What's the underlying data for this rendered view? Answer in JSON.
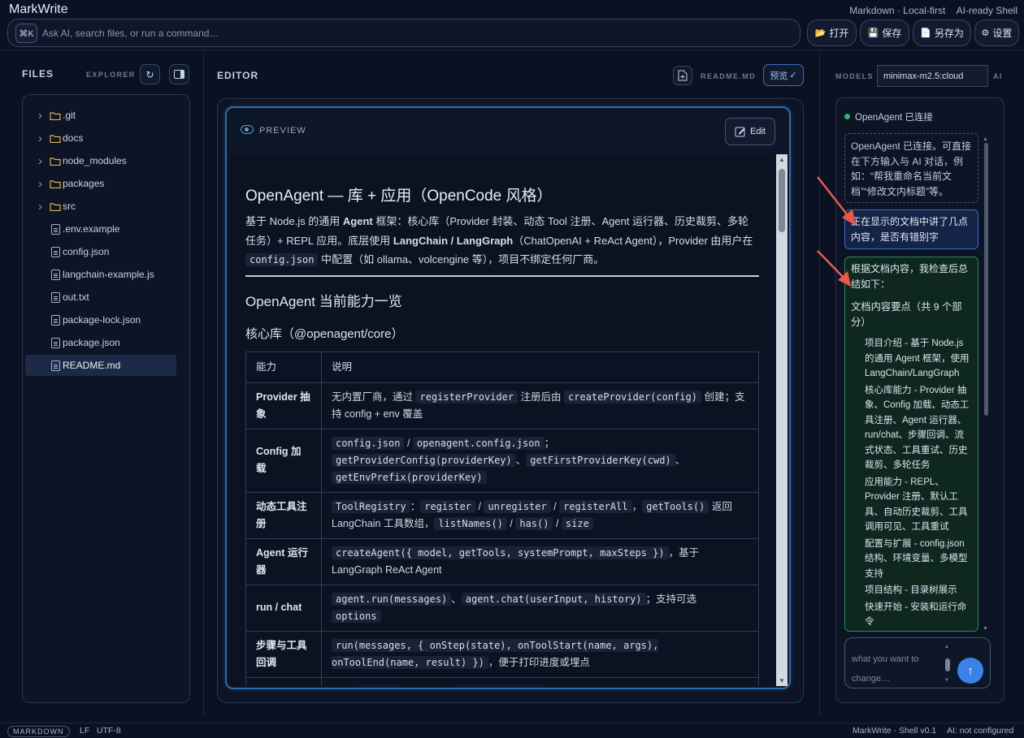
{
  "app": {
    "title": "MarkWrite",
    "tags": [
      "Markdown · Local-first",
      "AI-ready Shell"
    ]
  },
  "command_bar": {
    "shortcut": "⌘K",
    "placeholder": "Ask AI, search files, or run a command…"
  },
  "toolbar": {
    "open_label": "打开",
    "save_label": "保存",
    "save_as_label": "另存为",
    "settings_label": "设置"
  },
  "files": {
    "title": "FILES",
    "subtitle": "EXPLORER",
    "items": [
      {
        "name": ".git",
        "type": "folder"
      },
      {
        "name": "docs",
        "type": "folder"
      },
      {
        "name": "node_modules",
        "type": "folder"
      },
      {
        "name": "packages",
        "type": "folder"
      },
      {
        "name": "src",
        "type": "folder"
      },
      {
        "name": ".env.example",
        "type": "file"
      },
      {
        "name": "config.json",
        "type": "file"
      },
      {
        "name": "langchain-example.js",
        "type": "file"
      },
      {
        "name": "out.txt",
        "type": "file"
      },
      {
        "name": "package-lock.json",
        "type": "file"
      },
      {
        "name": "package.json",
        "type": "file"
      },
      {
        "name": "README.md",
        "type": "file",
        "active": true
      }
    ]
  },
  "editor": {
    "title": "EDITOR",
    "filename": "README.MD",
    "preview_toggle": "预览",
    "preview_label": "PREVIEW",
    "edit_label": "Edit"
  },
  "document": {
    "h1": "OpenAgent — 库 + 应用（OpenCode 风格）",
    "h2": "OpenAgent 当前能力一览",
    "h3": "核心库（@openagent/core）",
    "table_headers": [
      "能力",
      "说明"
    ]
  },
  "models": {
    "title": "MODELS",
    "current_model": "minimax-m2.5:cloud",
    "ai_label": "AI",
    "status": "OpenAgent 已连接"
  },
  "chat": {
    "system_msg": "OpenAgent 已连接。可直接在下方输入与 AI 对话，例如：“帮我重命名当前文档”“修改文内标题”等。",
    "user_msg": "正在显示的文档中讲了几点内容，是否有错别字",
    "ai_intro": "根据文档内容，我检查后总结如下：",
    "ai_section": "文档内容要点（共 9 个部分）",
    "ai_items": [
      "项目介绍 - 基于 Node.js 的通用 Agent 框架，使用 LangChain/LangGraph",
      "核心库能力 - Provider 抽象、Config 加载、动态工具注册、Agent 运行器、run/chat、步骤回调、流式状态、工具重试、历史裁剪、多轮任务",
      "应用能力 - REPL、Provider 注册、默认工具、自动历史裁剪、工具调用可见、工具重试",
      "配置与扩展 - config.json 结构、环境变量、多模型支持",
      "项目结构 - 目录树展示",
      "快速开始 - 安装和运行命令"
    ],
    "compose_placeholder": "what you want to change…",
    "send_icon": "arrow-up-icon"
  },
  "statusbar": {
    "mode": "MARKDOWN",
    "line_ending": "LF",
    "encoding": "UTF-8",
    "version": "MarkWrite · Shell v0.1",
    "ai_status": "AI: not configured"
  },
  "colors": {
    "background": "#0a1122",
    "accent": "#3b82e8",
    "preview_border": "#2d6dab",
    "user_bubble": "#3f6dc0",
    "ai_bubble": "#2c8a52",
    "connected": "#2fb86a",
    "annotation_arrow": "#e8594a"
  }
}
